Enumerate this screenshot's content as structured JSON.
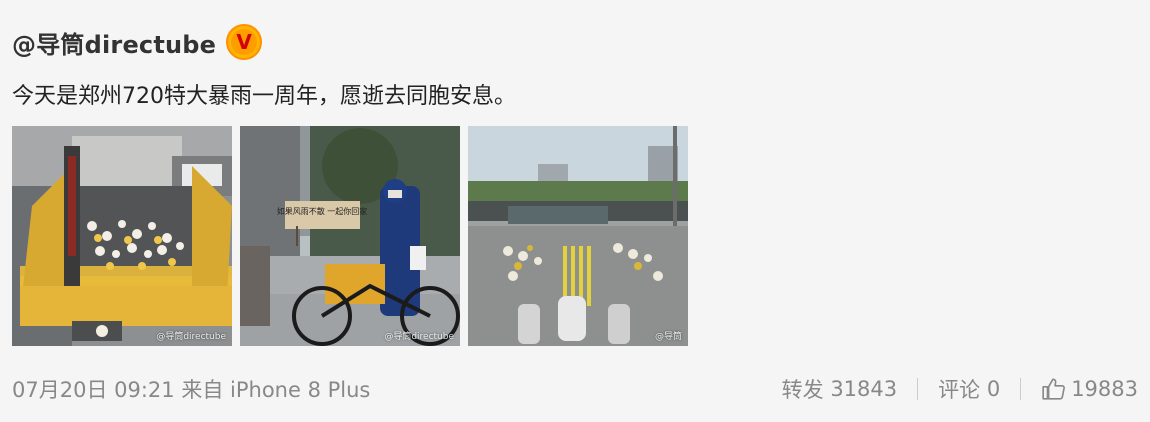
{
  "post": {
    "author": "@导筒directube",
    "badge": "V",
    "text": "今天是郑州720特大暴雨一周年，愿逝去同胞安息。",
    "photos": [
      {
        "watermark": "@导筒directube",
        "sign_text": ""
      },
      {
        "watermark": "@导筒directube",
        "sign_text": "如果风雨不散 一起你回家"
      },
      {
        "watermark": "@导筒",
        "sign_text": ""
      }
    ],
    "time": "07月20日 09:21",
    "source_prefix": "来自",
    "source": "iPhone 8 Plus"
  },
  "actions": {
    "repost_label": "转发",
    "repost_count": "31843",
    "comment_label": "评论",
    "comment_count": "0",
    "like_count": "19883",
    "like_icon": "thumbs-up-icon"
  },
  "colors": {
    "background": "#f5f5f5",
    "text": "#222222",
    "meta": "#888888",
    "badge": "#ffb400",
    "badge_text": "#d50000"
  }
}
